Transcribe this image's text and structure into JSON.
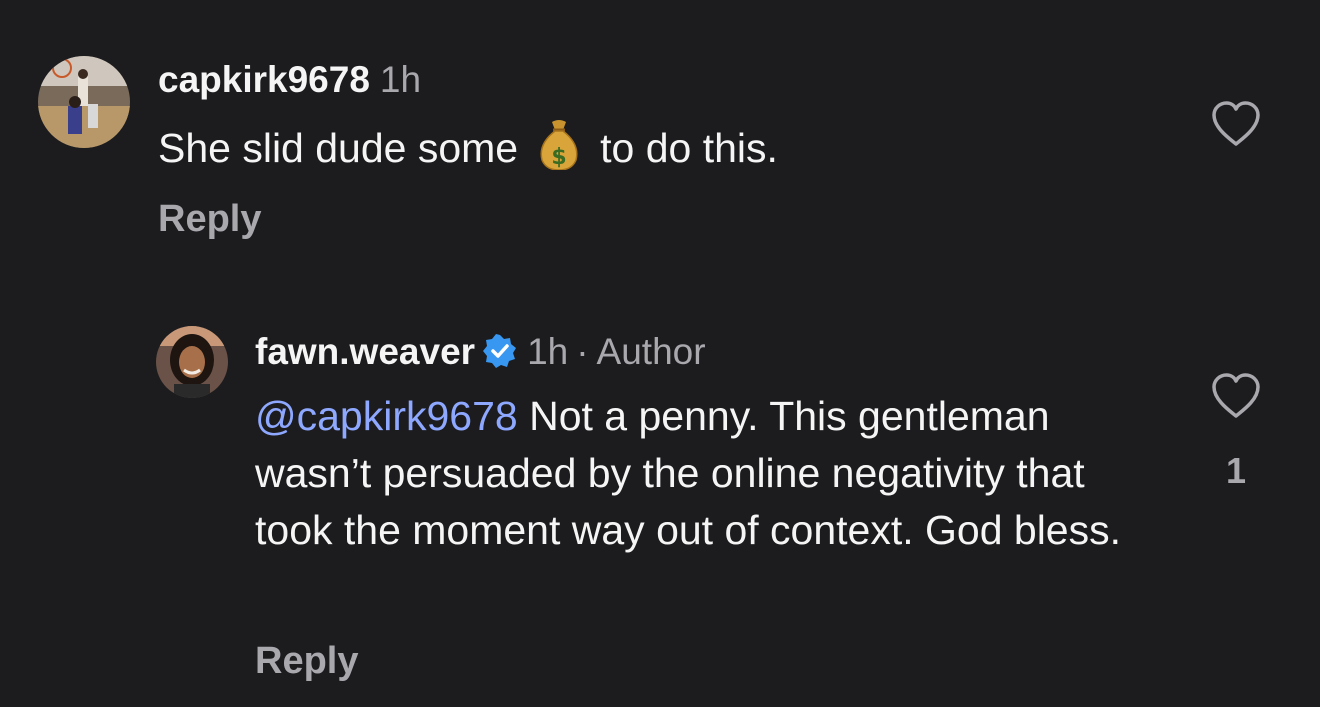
{
  "comments": [
    {
      "username": "capkirk9678",
      "time": "1h",
      "text_before_emoji": "She slid dude some",
      "emoji": "money-bag-icon",
      "text_after_emoji": "to do this.",
      "reply_label": "Reply"
    },
    {
      "username": "fawn.weaver",
      "verified": true,
      "time": "1h",
      "separator": "·",
      "author_label": "Author",
      "mention": "@capkirk9678",
      "text": " Not a penny. This gentleman wasn’t persuaded by the online negativity that took the moment way out of context. God bless.",
      "reply_label": "Reply",
      "like_count": "1"
    }
  ],
  "colors": {
    "background": "#1c1c1f",
    "primary_text": "#f5f5f5",
    "secondary_text": "#a8a8ad",
    "mention": "#8ea8ff",
    "verified_badge": "#3897f0"
  }
}
